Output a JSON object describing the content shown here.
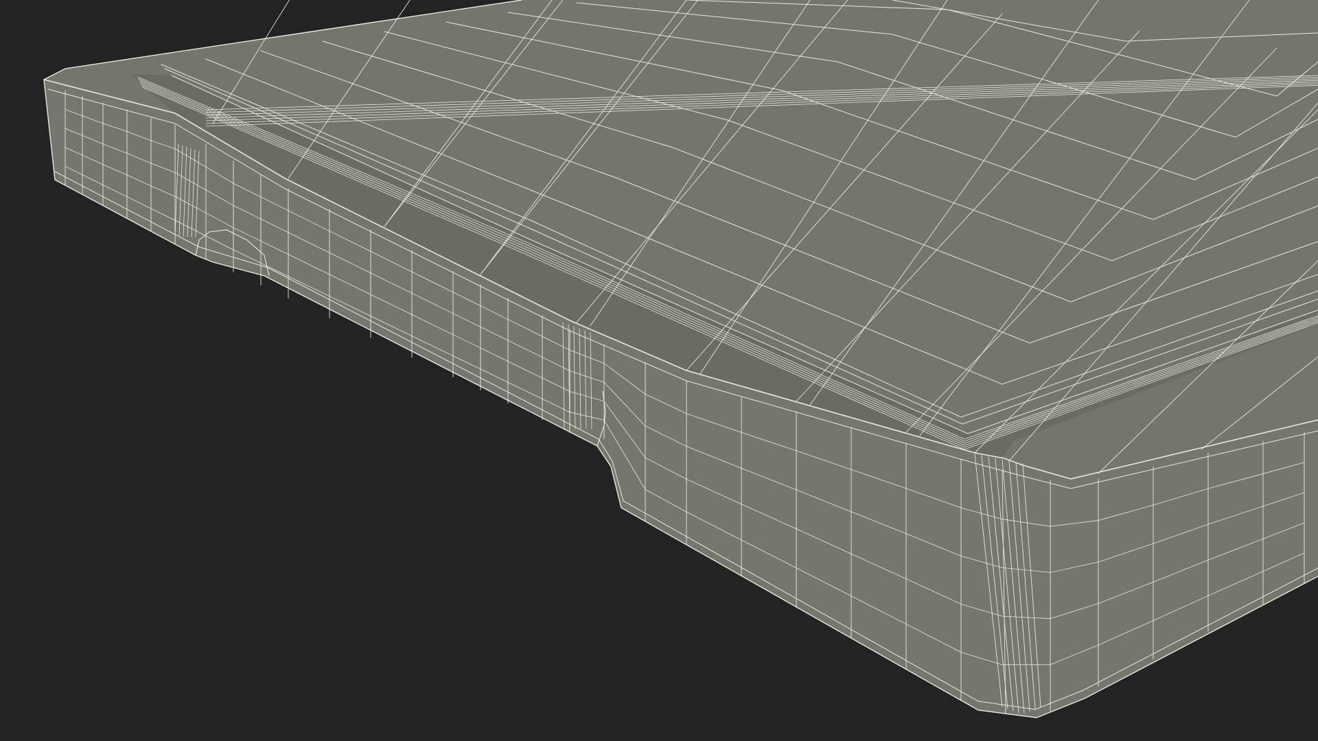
{
  "scene": {
    "subject_icon": "wireframe-mesh-icon",
    "colors": {
      "background": "#232323",
      "surface_top": "#74756b",
      "surface_side": "#75766d",
      "groove": "#6a6b61",
      "wire": "#e9e9dd"
    }
  }
}
